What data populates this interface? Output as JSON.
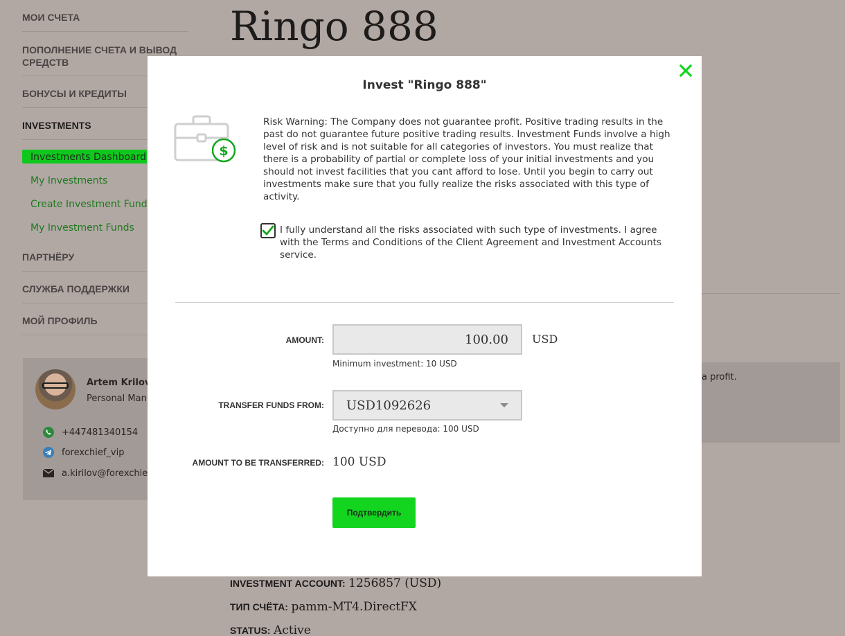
{
  "sidebar": {
    "items": [
      {
        "label": "МОИ СЧЕТА"
      },
      {
        "label": "ПОПОЛНЕНИЕ СЧЕТА И ВЫВОД СРЕДСТВ"
      },
      {
        "label": "БОНУСЫ И КРЕДИТЫ"
      },
      {
        "label": "INVESTMENTS"
      },
      {
        "label": "ПАРТНЁРУ"
      },
      {
        "label": "СЛУЖБА ПОДДЕРЖКИ"
      },
      {
        "label": "МОЙ ПРОФИЛЬ"
      }
    ],
    "subitems": [
      {
        "label": "Investments Dashboard"
      },
      {
        "label": "My Investments"
      },
      {
        "label": "Create Investment Fund"
      },
      {
        "label": "My Investment Funds"
      }
    ]
  },
  "manager": {
    "name": "Artem Krilov",
    "role": "Personal Man",
    "phone": "+447481340154",
    "telegram": "forexchief_vip",
    "email": "a.kirilov@forexchie"
  },
  "page": {
    "title": "Ringo 888",
    "right_text": "a profit.",
    "info": [
      {
        "key": "INVESTMENT ACCOUNT:",
        "value": "1256857 (USD)"
      },
      {
        "key": "ТИП СЧЁТА:",
        "value": "pamm-MT4.DirectFX"
      },
      {
        "key": "STATUS:",
        "value": "Active"
      }
    ]
  },
  "modal": {
    "title": "Invest \"Ringo 888\"",
    "risk_warning": "Risk Warning: The Company does not guarantee profit. Positive trading results in the past do not guarantee future positive trading results. Investment Funds involve a high level of risk and is not suitable for all categories of investors. You must realize that there is a probability of partial or complete loss of your initial investments and you should not invest facilities that you cant afford to lose. Until you begin to carry out investments make sure that you fully realize the risks associated with this type of activity.",
    "agree_text": "I fully understand all the risks associated with such type of investments. I agree with the Terms and Conditions of the Client Agreement and Investment Accounts service.",
    "amount_label": "AMOUNT:",
    "amount_value": "100.00",
    "currency": "USD",
    "min_investment": "Minimum investment: 10 USD",
    "transfer_from_label": "TRANSFER FUNDS FROM:",
    "transfer_from_value": "USD1092626",
    "available": "Доступно для перевода: 100 USD",
    "amount_transferred_label": "AMOUNT TO BE TRANSFERRED:",
    "amount_transferred_value": "100 USD",
    "confirm_label": "Подтвердить"
  },
  "colors": {
    "accent": "#13d41f",
    "link": "#1e7a1e",
    "overlay": "#b1a8a4"
  }
}
